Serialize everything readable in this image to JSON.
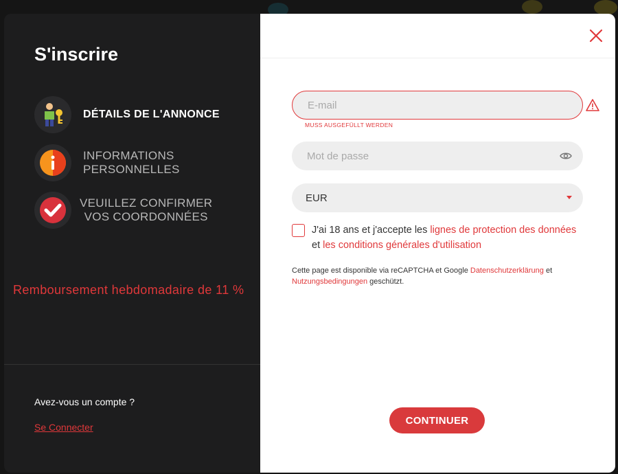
{
  "sidebar": {
    "title": "S'inscrire",
    "steps": [
      {
        "icon": "user-key-icon",
        "label": "DÉTAILS DE L'ANNONCE",
        "state": "active"
      },
      {
        "icon": "info-icon",
        "label_line1": "INFORMATIONS",
        "label_line2": "PERSONNELLES",
        "state": "inactive"
      },
      {
        "icon": "checkmark-icon",
        "label_line1": "VEUILLEZ CONFIRMER",
        "label_line2": "VOS COORDONNÉES",
        "state": "inactive"
      }
    ],
    "cashback": "Remboursement hebdomadaire de 11 %",
    "have_account": "Avez-vous un compte ?",
    "login_link": "Se Connecter"
  },
  "form": {
    "email_placeholder": "E-mail",
    "email_error": "MUSS AUSGEFÜLLT WERDEN",
    "password_placeholder": "Mot de passe",
    "currency_selected": "EUR",
    "agree_prefix": "J'ai 18 ans et j'accepte les ",
    "agree_link1": "lignes de protection des données",
    "agree_mid": "et ",
    "agree_link2": "les conditions générales d'utilisation",
    "recaptcha_prefix": "Cette page est disponible via reCAPTCHA et Google ",
    "recaptcha_link1": "Datenschutzerklärung",
    "recaptcha_mid": " et",
    "recaptcha_link2": "Nutzungsbedingungen",
    "recaptcha_suffix": " geschützt.",
    "continue_label": "CONTINUER"
  },
  "colors": {
    "accent": "#e0383a",
    "dark_panel": "#1d1d1e",
    "field_bg": "#eeeeee"
  }
}
